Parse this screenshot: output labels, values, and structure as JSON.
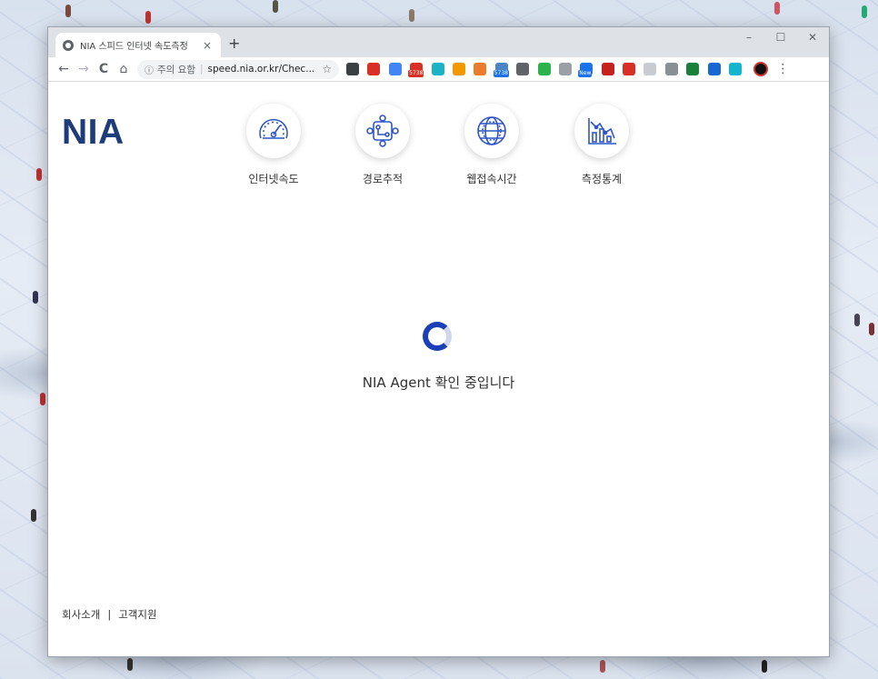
{
  "browser": {
    "tab": {
      "title": "NIA 스피드 인터넷 속도측정",
      "close_icon": "×",
      "favicon": "globe-icon"
    },
    "new_tab_label": "+",
    "window_controls": {
      "minimize": "–",
      "maximize": "☐",
      "close": "✕"
    },
    "nav": {
      "back": "←",
      "forward": "→",
      "reload": "C",
      "home": "⌂"
    },
    "omnibox": {
      "info_icon": "ⓘ",
      "security_text": "주의 요함",
      "url": "speed.nia.or.kr/Chec...",
      "star_icon": "☆"
    },
    "extensions": [
      {
        "name": "arrow-ext-icon",
        "color": "#3c4043"
      },
      {
        "name": "red-ext-icon",
        "color": "#d93025"
      },
      {
        "name": "translate-ext-icon",
        "color": "#4285f4"
      },
      {
        "name": "gmail-ext-icon",
        "color": "#d93025",
        "badge": "5738"
      },
      {
        "name": "gear-ext-icon",
        "color": "#1ab2c7"
      },
      {
        "name": "orange-ext-icon",
        "color": "#f29900"
      },
      {
        "name": "rx-ext-icon",
        "color": "#ea7c2c"
      },
      {
        "name": "cloud-ext-icon",
        "color": "#4a86c7",
        "badge": "5738",
        "badge_blue": true
      },
      {
        "name": "dark-ext-icon",
        "color": "#5f6368"
      },
      {
        "name": "feedly-ext-icon",
        "color": "#2bb24c"
      },
      {
        "name": "gray-ext-icon",
        "color": "#9aa0a6"
      },
      {
        "name": "new-ext-icon",
        "color": "#1a73e8",
        "badge": "New",
        "badge_blue": true
      },
      {
        "name": "play-ext-icon",
        "color": "#c5221f"
      },
      {
        "name": "pin-ext-icon",
        "color": "#d93025"
      },
      {
        "name": "cursor-ext-icon",
        "color": "#c8ccd0"
      },
      {
        "name": "window-ext-icon",
        "color": "#8a8f94"
      },
      {
        "name": "green-ext-icon",
        "color": "#188038"
      },
      {
        "name": "blue-ext-icon",
        "color": "#1967d2"
      },
      {
        "name": "infinity-ext-icon",
        "color": "#12b5cb"
      }
    ],
    "menu_icon": "⋮"
  },
  "page": {
    "logo": "NIA",
    "menu": [
      {
        "label": "인터넷속도",
        "icon": "speedometer-icon"
      },
      {
        "label": "경로추적",
        "icon": "route-icon"
      },
      {
        "label": "웹접속시간",
        "icon": "globe-icon"
      },
      {
        "label": "측정통계",
        "icon": "statistics-icon"
      }
    ],
    "status_text": "NIA Agent 확인 중입니다",
    "footer": {
      "about": "회사소개",
      "separator": "|",
      "support": "고객지원"
    }
  },
  "colors": {
    "brand": "#1f3c7a",
    "spinner": "#1a3fb8",
    "icon_stroke": "#2f55c8"
  }
}
